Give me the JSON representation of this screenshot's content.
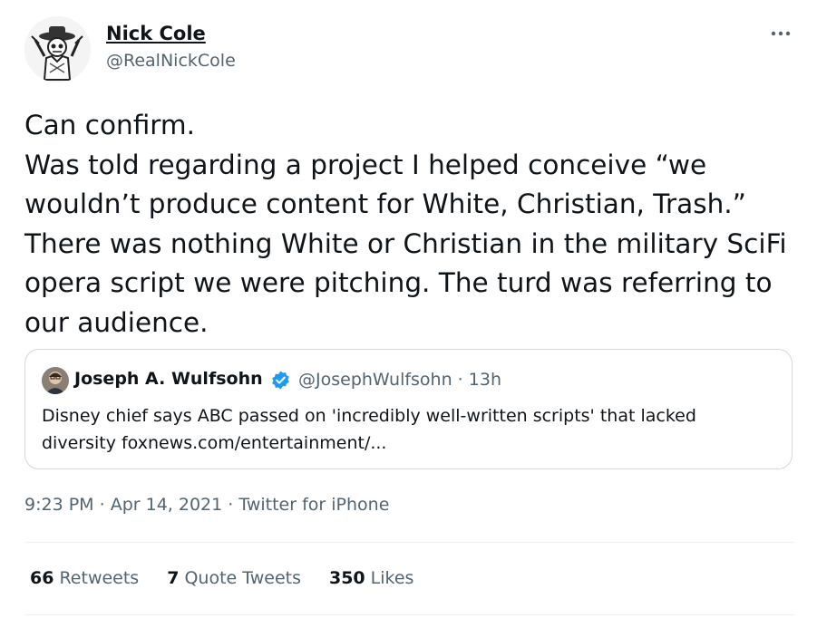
{
  "author": {
    "name": "Nick Cole",
    "handle": "@RealNickCole"
  },
  "tweet": {
    "text": "Can confirm.\nWas told regarding a project I helped conceive “we wouldn’t produce content for  White, Christian, Trash.”  There was nothing White or Christian in the military SciFi opera script we were pitching.  The turd was referring to our audience."
  },
  "quote": {
    "name": "Joseph A. Wulfsohn",
    "handle_time": "@JosephWulfsohn · 13h",
    "text": "Disney chief says ABC passed on 'incredibly well-written scripts' that lacked diversity foxnews.com/entertainment/..."
  },
  "meta": {
    "time": "9:23 PM",
    "sep1": "·",
    "date": "Apr 14, 2021",
    "sep2": "·",
    "source": "Twitter for iPhone"
  },
  "stats": {
    "retweets_count": "66",
    "retweets_label": "Retweets",
    "quotes_count": "7",
    "quotes_label": "Quote Tweets",
    "likes_count": "350",
    "likes_label": "Likes"
  },
  "colors": {
    "text": "#0f1419",
    "secondary": "#536471",
    "border": "#cfd9de",
    "verified": "#1d9bf0"
  }
}
